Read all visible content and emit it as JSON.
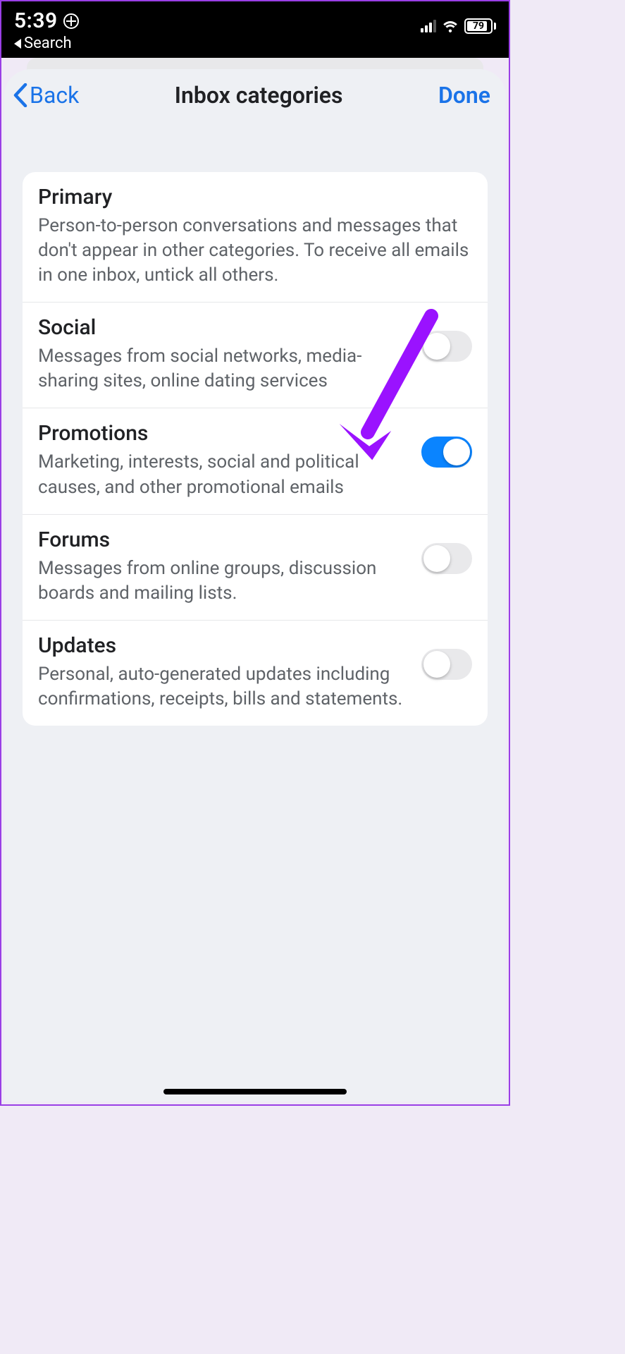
{
  "status": {
    "time": "5:39",
    "back_app": "Search",
    "battery_pct": "79"
  },
  "nav": {
    "back": "Back",
    "title": "Inbox categories",
    "done": "Done"
  },
  "categories": [
    {
      "key": "primary",
      "title": "Primary",
      "desc": "Person-to-person conversations and messages that don't appear in other categories. To receive all emails in one inbox, untick all others.",
      "has_toggle": false,
      "on": true
    },
    {
      "key": "social",
      "title": "Social",
      "desc": "Messages from social networks, media-sharing sites, online dating services",
      "has_toggle": true,
      "on": false
    },
    {
      "key": "promotions",
      "title": "Promotions",
      "desc": "Marketing, interests, social and political causes, and other promotional emails",
      "has_toggle": true,
      "on": true
    },
    {
      "key": "forums",
      "title": "Forums",
      "desc": "Messages from online groups, discussion boards and mailing lists.",
      "has_toggle": true,
      "on": false
    },
    {
      "key": "updates",
      "title": "Updates",
      "desc": "Personal, auto-generated updates including confirmations, receipts, bills and statements.",
      "has_toggle": true,
      "on": false
    }
  ],
  "annotation": {
    "target": "promotions",
    "color": "#9a12ff"
  }
}
